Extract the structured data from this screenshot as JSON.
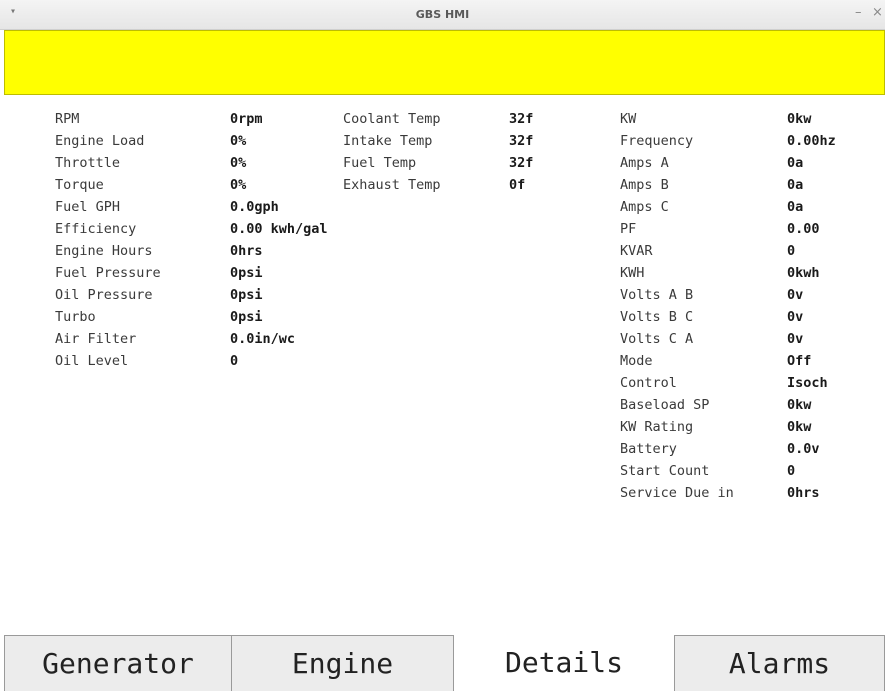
{
  "window": {
    "title": "GBS HMI",
    "menu_icon": "chevron-down-icon",
    "minimize_glyph": "–",
    "close_glyph": "×"
  },
  "banner": {
    "color": "#ffff00",
    "text": ""
  },
  "details": {
    "col1": [
      {
        "label": "RPM",
        "value": "0rpm"
      },
      {
        "label": "Engine Load",
        "value": "0%"
      },
      {
        "label": "Throttle",
        "value": "0%"
      },
      {
        "label": "Torque",
        "value": "0%"
      },
      {
        "label": "Fuel GPH",
        "value": "0.0gph"
      },
      {
        "label": "Efficiency",
        "value": "0.00 kwh/gal"
      },
      {
        "label": "Engine Hours",
        "value": "0hrs"
      },
      {
        "label": "Fuel Pressure",
        "value": "0psi"
      },
      {
        "label": "Oil Pressure",
        "value": "0psi"
      },
      {
        "label": "Turbo",
        "value": "0psi"
      },
      {
        "label": "Air Filter",
        "value": "0.0in/wc"
      },
      {
        "label": "Oil Level",
        "value": "0"
      }
    ],
    "col2": [
      {
        "label": "Coolant Temp",
        "value": "32f"
      },
      {
        "label": "Intake Temp",
        "value": "32f"
      },
      {
        "label": "Fuel Temp",
        "value": "32f"
      },
      {
        "label": "Exhaust Temp",
        "value": "0f"
      }
    ],
    "col3": [
      {
        "label": "KW",
        "value": "0kw"
      },
      {
        "label": "Frequency",
        "value": "0.00hz"
      },
      {
        "label": "Amps A",
        "value": "0a"
      },
      {
        "label": "Amps B",
        "value": "0a"
      },
      {
        "label": "Amps C",
        "value": "0a"
      },
      {
        "label": "PF",
        "value": "0.00"
      },
      {
        "label": "KVAR",
        "value": "0"
      },
      {
        "label": "KWH",
        "value": "0kwh"
      },
      {
        "label": "Volts A B",
        "value": "0v"
      },
      {
        "label": "Volts B C",
        "value": "0v"
      },
      {
        "label": "Volts C A",
        "value": "0v"
      },
      {
        "label": "Mode",
        "value": "Off"
      },
      {
        "label": "Control",
        "value": "Isoch"
      },
      {
        "label": "Baseload SP",
        "value": "0kw"
      },
      {
        "label": "KW Rating",
        "value": "0kw"
      },
      {
        "label": "Battery",
        "value": "0.0v"
      },
      {
        "label": "Start Count",
        "value": "0"
      },
      {
        "label": "Service Due in",
        "value": "0hrs"
      }
    ]
  },
  "tabs": [
    {
      "label": "Generator",
      "active": false
    },
    {
      "label": "Engine",
      "active": false
    },
    {
      "label": "Details",
      "active": true
    },
    {
      "label": "Alarms",
      "active": false
    }
  ]
}
